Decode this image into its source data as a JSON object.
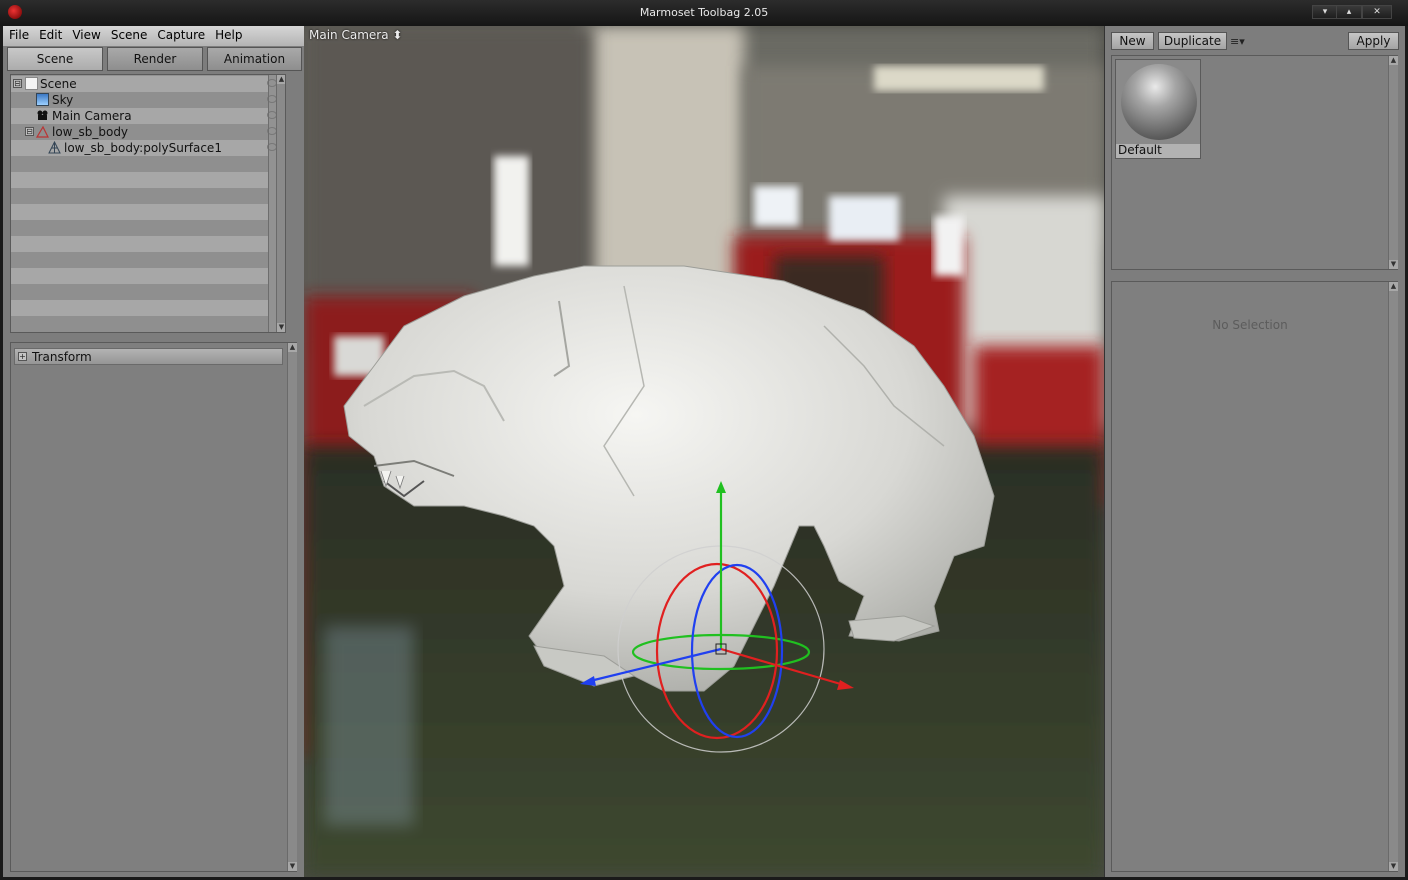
{
  "window": {
    "title": "Marmoset Toolbag 2.05",
    "controls": [
      "▾",
      "▴",
      "✕"
    ]
  },
  "menu": [
    "File",
    "Edit",
    "View",
    "Scene",
    "Capture",
    "Help"
  ],
  "tabs": [
    {
      "label": "Scene",
      "active": true
    },
    {
      "label": "Render",
      "active": false
    },
    {
      "label": "Animation",
      "active": false
    }
  ],
  "tree": [
    {
      "label": "Scene",
      "icon": "document-icon",
      "expander": "⊟",
      "indent": 0
    },
    {
      "label": "Sky",
      "icon": "sky-icon",
      "indent": 1
    },
    {
      "label": "Main Camera",
      "icon": "camera-icon",
      "indent": 1
    },
    {
      "label": "low_sb_body",
      "icon": "mesh-icon",
      "expander": "⊟",
      "indent": 1
    },
    {
      "label": "low_sb_body:polySurface1",
      "icon": "submesh-icon",
      "indent": 2
    }
  ],
  "transform": {
    "label": "Transform"
  },
  "viewport": {
    "camera_label": "Main Camera ⬍"
  },
  "materials": {
    "new_label": "New",
    "duplicate_label": "Duplicate",
    "menu_glyph": "≡▾",
    "apply_label": "Apply",
    "items": [
      {
        "name": "Default"
      }
    ]
  },
  "properties": {
    "empty_text": "No Selection"
  },
  "colors": {
    "gizmo_x": "#e02020",
    "gizmo_y": "#20c020",
    "gizmo_z": "#2040f0",
    "panel": "#7d7d7d"
  }
}
